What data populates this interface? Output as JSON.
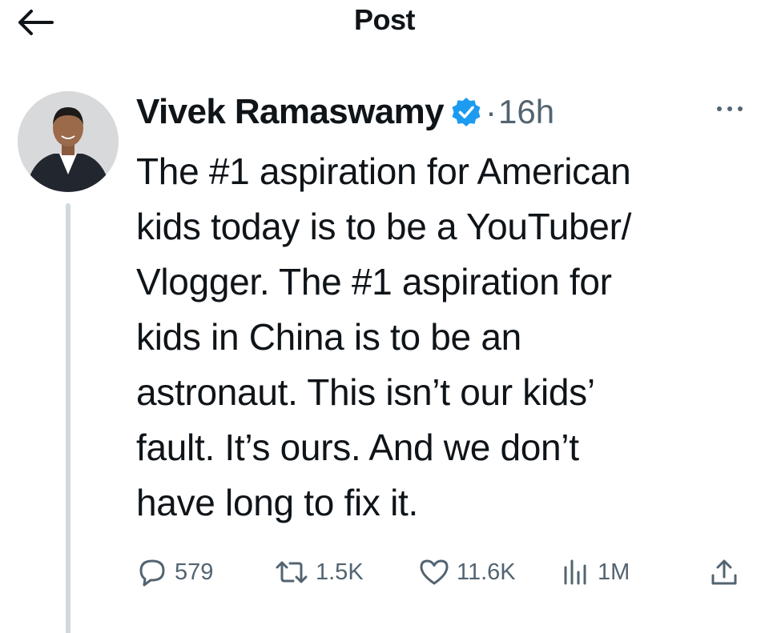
{
  "header": {
    "title": "Post"
  },
  "post": {
    "author_name": "Vivek Ramaswamy",
    "separator": "·",
    "time": "16h",
    "lines": [
      "The #1 aspiration for American",
      "kids today is to be a YouTuber/",
      "Vlogger. The #1 aspiration for",
      "kids in China is to be an",
      "astronaut. This isn’t our kids’",
      "fault. It’s ours. And we don’t",
      "have long to fix it."
    ]
  },
  "actions": {
    "replies": "579",
    "reposts": "1.5K",
    "likes": "11.6K",
    "views": "1M"
  },
  "icons": {
    "back": "arrow-left-icon",
    "verified": "verified-badge-icon",
    "more": "more-horizontal-icon",
    "reply": "reply-bubble-icon",
    "repost": "repost-icon",
    "like": "heart-icon",
    "views": "bar-chart-icon",
    "share": "share-upload-icon"
  },
  "colors": {
    "text": "#0f1419",
    "secondary": "#536471",
    "verified_blue": "#1d9bf0",
    "thread_line": "#cfd9de"
  }
}
